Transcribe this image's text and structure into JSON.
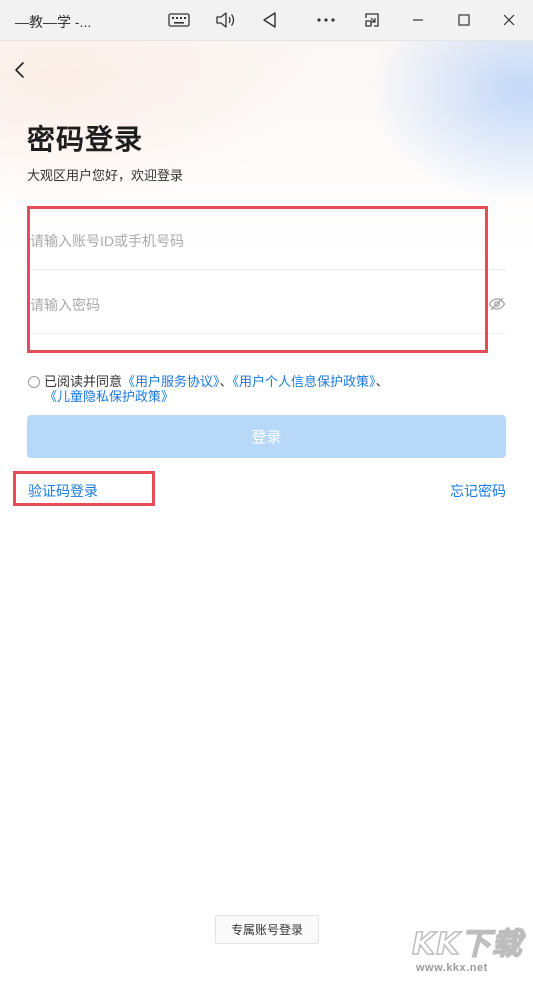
{
  "window": {
    "title": "—教—学 -..."
  },
  "page": {
    "title": "密码登录",
    "subtitle": "大观区用户您好，欢迎登录"
  },
  "form": {
    "account_placeholder": "请输入账号ID或手机号码",
    "password_placeholder": "请输入密码",
    "agree_prefix": "已阅读并同意",
    "agree_link_1": "《用户服务协议》",
    "agree_sep_1": "、",
    "agree_link_2": "《用户个人信息保护政策》",
    "agree_sep_2": "、",
    "agree_link_3": "《儿童隐私保护政策》",
    "login_button": "登录",
    "sms_login": "验证码登录",
    "forgot_password": "忘记密码"
  },
  "footer": {
    "exclusive_login": "专属账号登录"
  },
  "watermark": {
    "chars": [
      "K",
      "K",
      "下",
      "载"
    ],
    "url": "www.kkx.net"
  },
  "colors": {
    "accent": "#1a7ae0",
    "login_button_disabled": "#b8d8fa",
    "highlight_box": "#e74c55"
  },
  "icons": [
    "keyboard-icon",
    "volume-icon",
    "back-triangle-icon",
    "more-icon",
    "snap-icon",
    "minimize-icon",
    "maximize-icon",
    "close-icon",
    "back-chevron-icon",
    "eye-off-icon"
  ]
}
